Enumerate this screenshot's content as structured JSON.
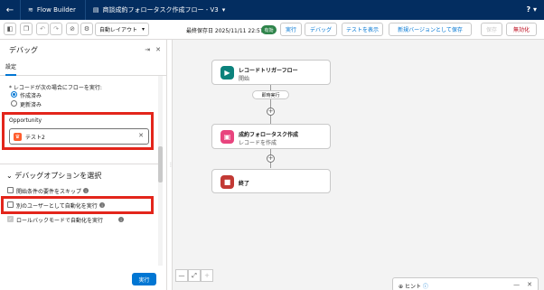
{
  "header": {
    "app_name": "Flow Builder",
    "flow_title": "商談成約フォロータスク作成フロー - V3",
    "help_label": "?"
  },
  "toolbar": {
    "layout_label": "自動レイアウト",
    "last_saved": "最終保存日 2025/11/11 22:57",
    "status_badge": "有効",
    "run_label": "実行",
    "debug_label": "デバッグ",
    "view_tests_label": "テストを表示",
    "save_new_version_label": "新規バージョンとして保存",
    "save_label": "保存",
    "deactivate_label": "無効化"
  },
  "debug_panel": {
    "title": "デバッグ",
    "tab_label": "設定",
    "trigger_question": "* レコードが次の場合にフローを実行:",
    "radio_created": "作成済み",
    "radio_updated": "更新済み",
    "record_label": "Opportunity",
    "record_value": "テスト2",
    "options_heading": "デバッグオプションを選択",
    "opt_skip_start": "開始条件の要件をスキップ",
    "opt_run_as_user": "別のユーザーとして自動化を実行",
    "opt_rollback": "ロールバックモードで自動化を実行",
    "run_button": "実行"
  },
  "canvas": {
    "start_node_title": "レコードトリガーフロー",
    "start_node_sub": "開始",
    "path_label": "即時実行",
    "create_node_title": "成約フォロータスク作成",
    "create_node_sub": "レコードを作成",
    "end_node_title": "終了",
    "hint_label": "ヒント"
  },
  "colors": {
    "header_bg": "#032d60",
    "brand_blue": "#0176d3",
    "highlight_red": "#e3251b",
    "start_green": "#0b827c",
    "create_pink": "#e8447e",
    "end_red": "#c23934"
  }
}
